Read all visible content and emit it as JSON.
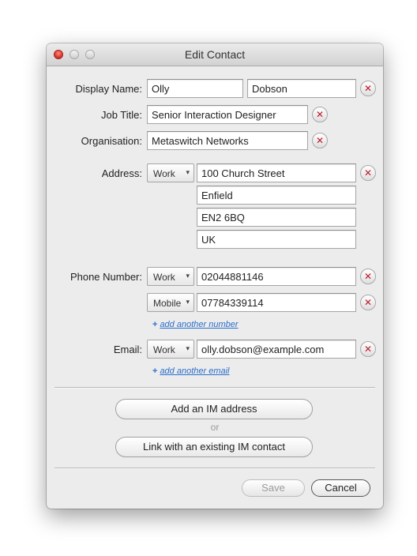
{
  "window": {
    "title": "Edit Contact"
  },
  "labels": {
    "display_name": "Display Name:",
    "job_title": "Job Title:",
    "organisation": "Organisation:",
    "address": "Address:",
    "phone_number": "Phone Number:",
    "email": "Email:"
  },
  "fields": {
    "first_name": "Olly",
    "last_name": "Dobson",
    "job_title": "Senior Interaction Designer",
    "organisation": "Metaswitch Networks"
  },
  "address": {
    "type": "Work",
    "lines": [
      "100 Church Street",
      "Enfield",
      "EN2 6BQ",
      "UK"
    ]
  },
  "phones": [
    {
      "type": "Work",
      "number": "02044881146"
    },
    {
      "type": "Mobile",
      "number": "07784339114"
    }
  ],
  "email": {
    "type": "Work",
    "value": "olly.dobson@example.com"
  },
  "links": {
    "plus": "+",
    "add_number": "add another number",
    "add_email": "add another email"
  },
  "icons": {
    "remove": "✕",
    "dropdown": "▾"
  },
  "buttons": {
    "add_im": "Add an IM address",
    "or": "or",
    "link_im": "Link with an existing IM contact",
    "save": "Save",
    "cancel": "Cancel"
  },
  "colors": {
    "remove_icon": "#c0182a",
    "link": "#2b6fcc",
    "close_light": "#d12b1f"
  }
}
